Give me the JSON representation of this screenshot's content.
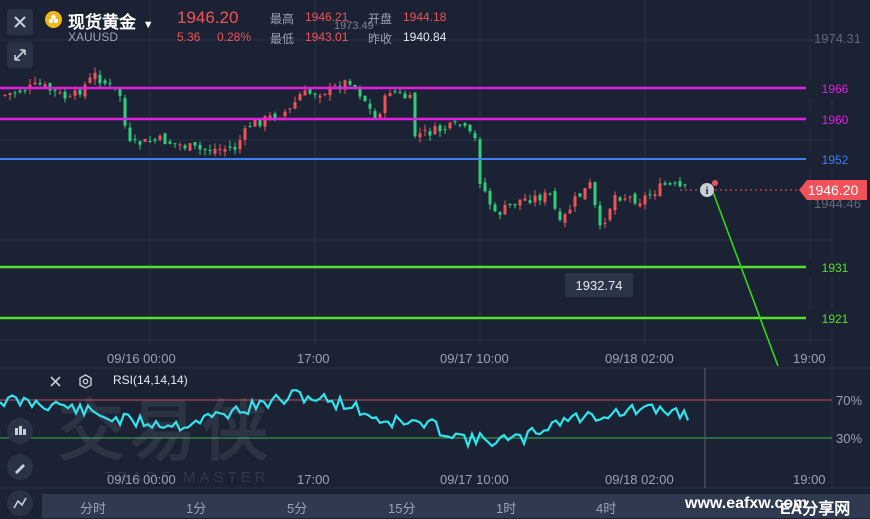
{
  "header": {
    "title": "现货黄金",
    "symbol": "XAUUSD",
    "price": "1946.20",
    "change": "5.36",
    "change_pct": "0.28%",
    "high_label": "最高",
    "high": "1946.21",
    "open_label": "开盘",
    "open": "1944.18",
    "low_label": "最低",
    "low": "1943.01",
    "prev_close_label": "昨收",
    "prev_close": "1940.84"
  },
  "price_axis": {
    "top": "1974.31",
    "mid": "1944.46",
    "current": "1946.20",
    "chart_high_label": "1973.49"
  },
  "levels": [
    {
      "value": "1966",
      "color": "#e21ee0"
    },
    {
      "value": "1960",
      "color": "#e21ee0"
    },
    {
      "value": "1952",
      "color": "#3f7ef0"
    },
    {
      "value": "1931",
      "color": "#55e12b"
    },
    {
      "value": "1921",
      "color": "#55e12b"
    }
  ],
  "tooltip_low": "1932.74",
  "time_axis": [
    "09/16 00:00",
    "17:00",
    "09/17 10:00",
    "09/18 02:00",
    "19:00"
  ],
  "rsi": {
    "label": "RSI(14,14,14)",
    "upper": "70%",
    "lower": "30%"
  },
  "watermark": {
    "main": "交易侠",
    "sub": "TRADE MASTER"
  },
  "periods": [
    "分时",
    "1分",
    "5分",
    "15分",
    "1时",
    "4时"
  ],
  "footer": {
    "url": "www.eafxw.com",
    "site": "EA分享网"
  },
  "colors": {
    "up": "#f1525a",
    "down": "#2fce7a",
    "rsi": "#2ee6f0",
    "bg": "#1b2233"
  }
}
